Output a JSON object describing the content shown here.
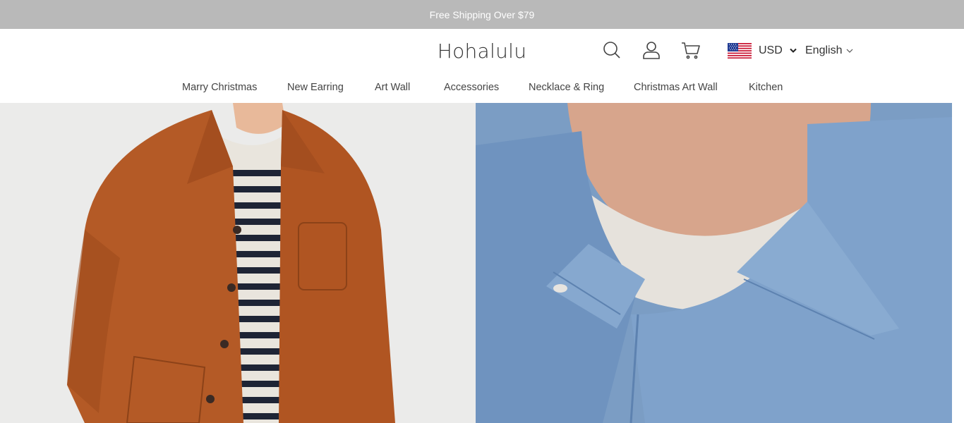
{
  "announcement": {
    "text": "Free Shipping Over $79"
  },
  "header": {
    "logo": "Hohalulu",
    "icons": {
      "search": "search-icon",
      "account": "user-icon",
      "cart": "cart-icon"
    },
    "currency": {
      "label": "USD",
      "flag": "us-flag-icon"
    },
    "language": {
      "label": "English"
    }
  },
  "nav": {
    "items": [
      {
        "label": "Marry Christmas"
      },
      {
        "label": "New Earring"
      },
      {
        "label": "Art Wall"
      },
      {
        "label": "Accessories"
      },
      {
        "label": "Necklace & Ring"
      },
      {
        "label": "Christmas Art Wall"
      },
      {
        "label": "Kitchen"
      }
    ]
  },
  "colors": {
    "announcement_bg": "#b9b9b9",
    "text": "#333333",
    "left_panel_bg": "#ebebea",
    "jacket_orange": "#b45a26",
    "right_panel_bg": "#7b9dc4"
  }
}
